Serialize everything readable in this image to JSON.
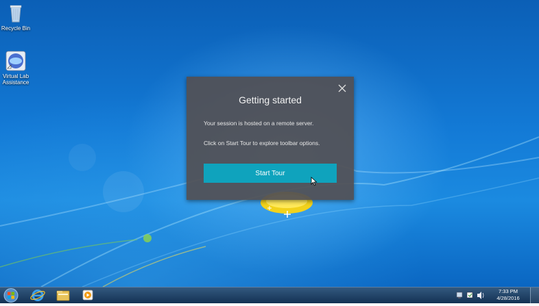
{
  "desktop": {
    "icons": [
      {
        "label": "Recycle Bin",
        "icon": "recycle-bin-icon"
      },
      {
        "label": "Virtual Lab Assistance",
        "icon": "virtual-lab-icon"
      }
    ]
  },
  "dialog": {
    "title": "Getting started",
    "line1": "Your session is hosted on a remote server.",
    "line2": "Click on Start Tour to explore toolbar options.",
    "button": "Start Tour",
    "close_icon": "close-icon",
    "button_color": "#0fa3bd"
  },
  "taskbar": {
    "pinned": [
      "internet-explorer-icon",
      "file-explorer-icon",
      "media-player-icon"
    ],
    "tray_icons": [
      "network-icon",
      "action-center-icon",
      "volume-icon"
    ],
    "time": "7:33 PM",
    "date": "4/28/2016"
  }
}
